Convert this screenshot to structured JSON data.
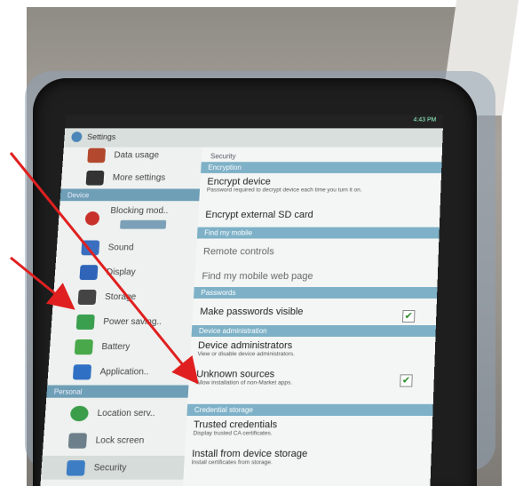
{
  "statusbar": {
    "time": "4:43 PM"
  },
  "actionbar": {
    "title": "Settings"
  },
  "left_list": {
    "items": [
      {
        "label": "Data usage"
      },
      {
        "label": "More settings"
      },
      {
        "label": "Blocking mod.."
      },
      {
        "label": "Sound"
      },
      {
        "label": "Display"
      },
      {
        "label": "Storage"
      },
      {
        "label": "Power saving.."
      },
      {
        "label": "Battery"
      },
      {
        "label": "Application.."
      },
      {
        "label": "Location serv.."
      },
      {
        "label": "Lock screen"
      },
      {
        "label": "Security"
      }
    ],
    "sections": {
      "device": "Device",
      "personal": "Personal"
    }
  },
  "right_pane": {
    "heading": "Security",
    "sections": {
      "encryption": "Encryption",
      "find_my_mobile": "Find my mobile",
      "passwords": "Passwords",
      "device_admin": "Device administration",
      "credential_storage": "Credential storage"
    },
    "items": {
      "encrypt_device": {
        "title": "Encrypt device",
        "subtitle": "Password required to decrypt device each time you turn it on."
      },
      "encrypt_sd": {
        "title": "Encrypt external SD card"
      },
      "remote_controls": {
        "title": "Remote controls"
      },
      "find_web": {
        "title": "Find my mobile web page"
      },
      "make_passwords_visible": {
        "title": "Make passwords visible",
        "checked": "✔"
      },
      "device_administrators": {
        "title": "Device administrators",
        "subtitle": "View or disable device administrators."
      },
      "unknown_sources": {
        "title": "Unknown sources",
        "subtitle": "Allow installation of non-Market apps.",
        "checked": "✔"
      },
      "trusted_credentials": {
        "title": "Trusted credentials",
        "subtitle": "Display trusted CA certificates."
      },
      "install_from_storage": {
        "title": "Install from device storage",
        "subtitle": "Install certificates from storage."
      }
    }
  },
  "colors": {
    "arrow": "#e02020",
    "section": "#7eb1c7",
    "check": "#2a8a2a"
  }
}
